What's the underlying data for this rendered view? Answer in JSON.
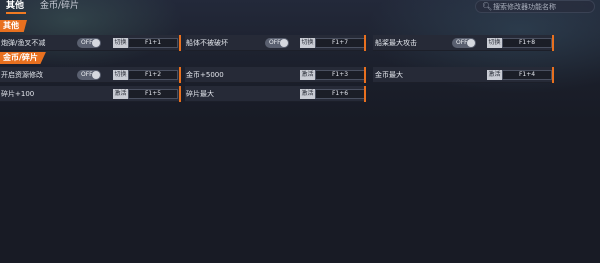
{
  "tabs": [
    {
      "label": "其他",
      "active": true
    },
    {
      "label": "金币/碎片",
      "active": false
    }
  ],
  "search": {
    "placeholder": "搜索修改器功能名称"
  },
  "sections": [
    {
      "title": "其他"
    },
    {
      "title": "金币/碎片"
    }
  ],
  "options": {
    "o1": {
      "name": "炮弹/渔叉不减",
      "toggle": "OFF",
      "mode": "切换",
      "hotkey": "F1+1"
    },
    "o2": {
      "name": "船体不被破坏",
      "toggle": "OFF",
      "mode": "切换",
      "hotkey": "F1+7"
    },
    "o3": {
      "name": "船桨最大攻击",
      "toggle": "OFF",
      "mode": "切换",
      "hotkey": "F1+8"
    },
    "o4": {
      "name": "开启资源修改",
      "toggle": "OFF",
      "mode": "切换",
      "hotkey": "F1+2"
    },
    "o5": {
      "name": "金币+5000",
      "mode": "激活",
      "hotkey": "F1+3"
    },
    "o6": {
      "name": "金币最大",
      "mode": "激活",
      "hotkey": "F1+4"
    },
    "o7": {
      "name": "碎片+100",
      "mode": "激活",
      "hotkey": "F1+5"
    },
    "o8": {
      "name": "碎片最大",
      "mode": "激活",
      "hotkey": "F1+6"
    }
  },
  "colors": {
    "accent": "#e8701f",
    "background": "#181b25",
    "row": "#262a37"
  },
  "icons": {
    "search": "search-icon"
  }
}
